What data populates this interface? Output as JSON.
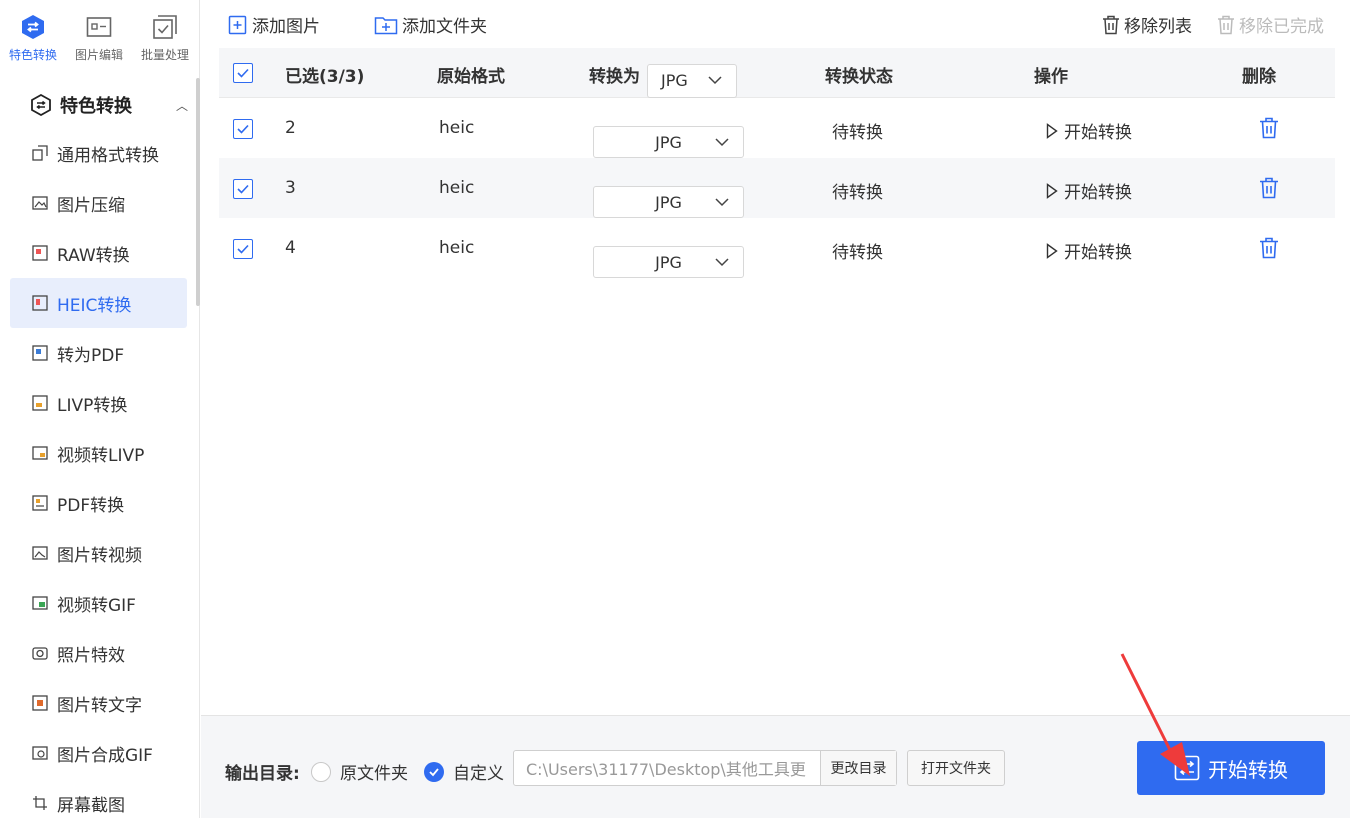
{
  "topnav": [
    {
      "label": "特色转换",
      "icon": "swap-icon",
      "active": true
    },
    {
      "label": "图片编辑",
      "icon": "image-edit-icon",
      "active": false
    },
    {
      "label": "批量处理",
      "icon": "batch-icon",
      "active": false
    }
  ],
  "sidebar": {
    "group_title": "特色转换",
    "items": [
      {
        "label": "通用格式转换",
        "icon": "convert-icon"
      },
      {
        "label": "图片压缩",
        "icon": "image-icon"
      },
      {
        "label": "RAW转换",
        "icon": "raw-icon"
      },
      {
        "label": "HEIC转换",
        "icon": "heic-icon",
        "active": true
      },
      {
        "label": "转为PDF",
        "icon": "pdf-icon"
      },
      {
        "label": "LIVP转换",
        "icon": "livp-icon"
      },
      {
        "label": "视频转LIVP",
        "icon": "video-icon"
      },
      {
        "label": "PDF转换",
        "icon": "pdf-convert-icon"
      },
      {
        "label": "图片转视频",
        "icon": "image-video-icon"
      },
      {
        "label": "视频转GIF",
        "icon": "gif-icon"
      },
      {
        "label": "照片特效",
        "icon": "camera-icon"
      },
      {
        "label": "图片转文字",
        "icon": "ocr-icon"
      },
      {
        "label": "图片合成GIF",
        "icon": "merge-gif-icon"
      },
      {
        "label": "屏幕截图",
        "icon": "screenshot-icon"
      }
    ]
  },
  "toolbar": {
    "add_image": "添加图片",
    "add_folder": "添加文件夹",
    "remove_list": "移除列表",
    "remove_done": "移除已完成"
  },
  "table": {
    "headers": {
      "selected": "已选(3/3)",
      "format": "原始格式",
      "convert_to": "转换为",
      "convert_to_value": "JPG",
      "status": "转换状态",
      "action": "操作",
      "delete": "删除"
    },
    "rows": [
      {
        "name": "2",
        "format": "heic",
        "target": "JPG",
        "status": "待转换",
        "action": "开始转换"
      },
      {
        "name": "3",
        "format": "heic",
        "target": "JPG",
        "status": "待转换",
        "action": "开始转换"
      },
      {
        "name": "4",
        "format": "heic",
        "target": "JPG",
        "status": "待转换",
        "action": "开始转换"
      }
    ]
  },
  "output": {
    "label": "输出目录:",
    "option_original": "原文件夹",
    "option_custom": "自定义",
    "path": "C:\\Users\\31177\\Desktop\\其他工具更",
    "change_dir": "更改目录",
    "open_folder": "打开文件夹",
    "start": "开始转换"
  },
  "colors": {
    "accent": "#2f6bf0",
    "arrow": "#ee3b3b"
  }
}
